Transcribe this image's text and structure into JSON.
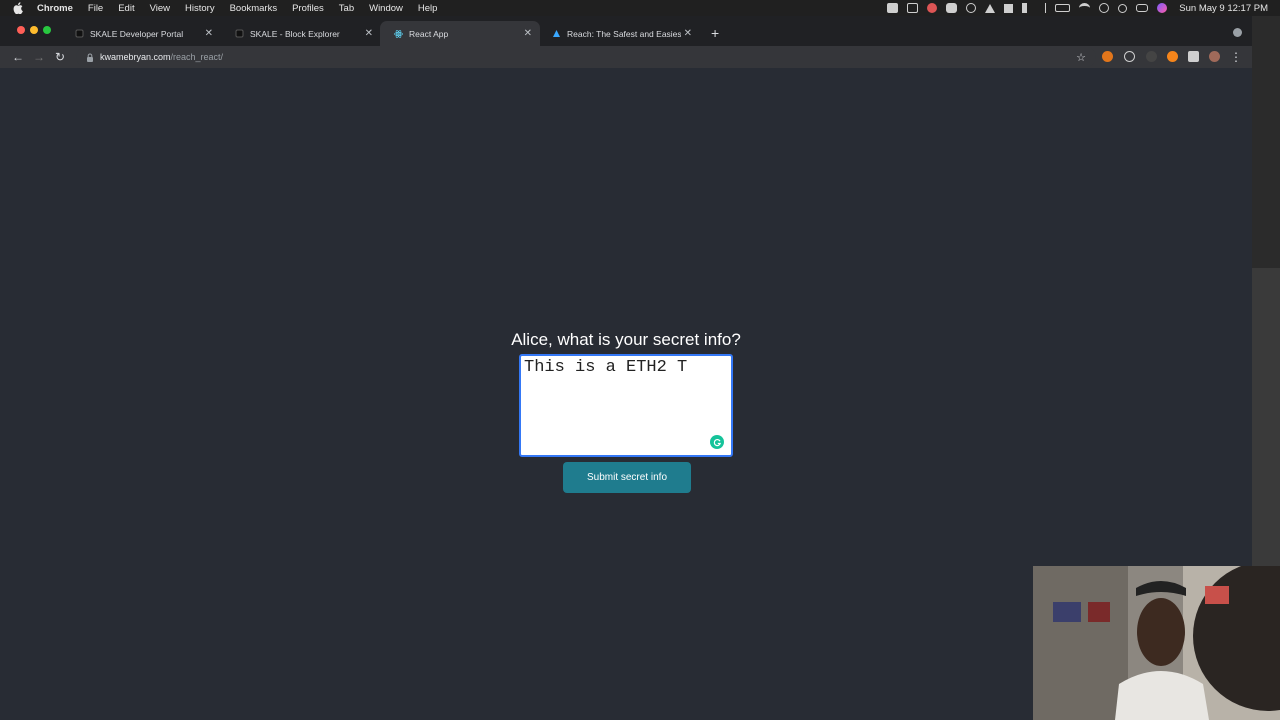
{
  "menubar": {
    "app_name": "Chrome",
    "items": [
      "File",
      "Edit",
      "View",
      "History",
      "Bookmarks",
      "Profiles",
      "Tab",
      "Window",
      "Help"
    ],
    "clock": "Sun May 9  12:17 PM"
  },
  "browser": {
    "tabs": [
      {
        "title": "SKALE Developer Portal",
        "icon": "skale-icon"
      },
      {
        "title": "SKALE - Block Explorer",
        "icon": "skale-icon"
      },
      {
        "title": "React App",
        "icon": "react-icon"
      },
      {
        "title": "Reach: The Safest and Easiest",
        "icon": "reach-icon"
      }
    ],
    "url_host": "kwamebryan.com",
    "url_path": "/reach_react/"
  },
  "page": {
    "prompt": "Alice, what is your secret info?",
    "secret_value": "This is a ETH2 T",
    "submit_label": "Submit secret info"
  },
  "colors": {
    "page_bg": "#282c34",
    "button_bg": "#1f7c8e",
    "focus_ring": "#3478f6",
    "grammarly": "#15c39a"
  }
}
